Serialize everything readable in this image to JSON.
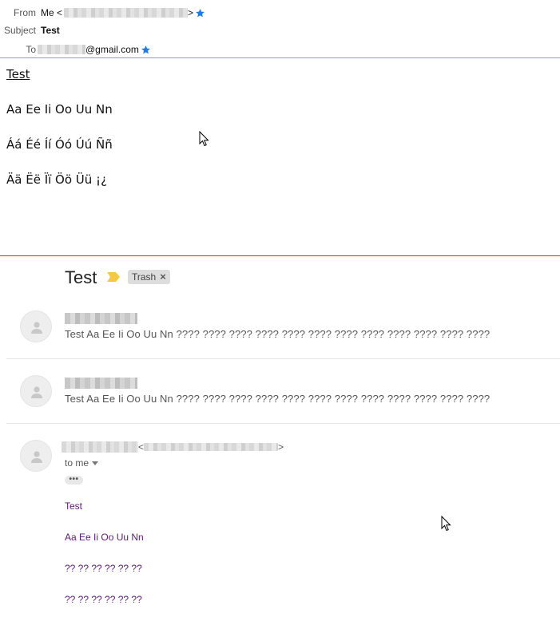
{
  "compose": {
    "from_label": "From",
    "from_name": "Me <",
    "from_close": ">",
    "subject_label": "Subject",
    "subject_value": "Test",
    "to_label": "To",
    "to_domain": "@gmail.com",
    "body_lines": [
      "Test",
      "Aa Ee Ii Oo Uu Nn",
      "Áá Éé Íí Óó Úú Ññ",
      "Ää Ëë Ïï Öö Üü ¡¿"
    ],
    "star_color": "#1e7be6"
  },
  "thread": {
    "subject": "Test",
    "importance_color": "#f5c842",
    "label_chip": "Trash",
    "label_remove": "×",
    "messages": [
      {
        "snippet": "Test Aa Ee Ii Oo Uu Nn ???? ???? ???? ???? ???? ???? ???? ???? ???? ???? ???? ????"
      },
      {
        "snippet": "Test Aa Ee Ii Oo Uu Nn ???? ???? ???? ???? ???? ???? ???? ???? ???? ???? ???? ????"
      }
    ],
    "expanded": {
      "sender_open": "<",
      "sender_close": ">",
      "to_me": "to me",
      "dots": "•••",
      "body_lines": [
        "Test",
        "Aa Ee Ii Oo Uu Nn",
        "?? ?? ?? ?? ?? ??",
        "?? ?? ?? ?? ?? ??"
      ],
      "body_color": "#5b1a7a"
    }
  }
}
